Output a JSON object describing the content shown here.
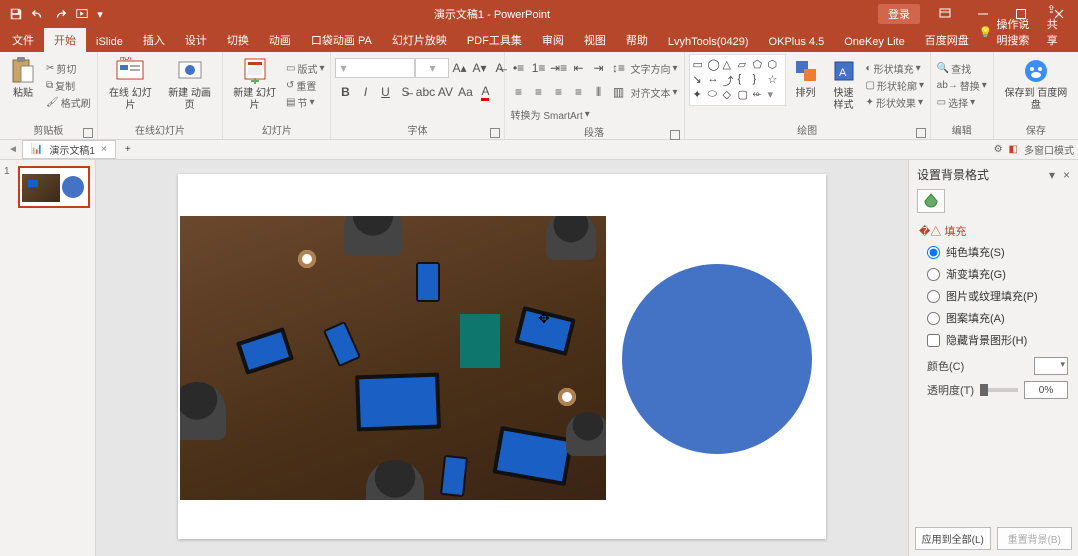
{
  "app": {
    "title": "演示文稿1 - PowerPoint",
    "login": "登录",
    "share": "共享",
    "hint": "操作说明搜索"
  },
  "tabs": [
    "文件",
    "开始",
    "iSlide",
    "插入",
    "设计",
    "切换",
    "动画",
    "口袋动画 PA",
    "幻灯片放映",
    "PDF工具集",
    "审阅",
    "视图",
    "帮助",
    "LvyhTools(0429)",
    "OKPlus 4.5",
    "OneKey Lite",
    "百度网盘"
  ],
  "active_tab": 1,
  "ribbon": {
    "clipboard": {
      "paste": "粘贴",
      "cut": "剪切",
      "copy": "复制",
      "painter": "格式刷",
      "label": "剪贴板"
    },
    "onlineslides": {
      "online": "在线\n幻灯片",
      "newpage": "新建\n动画页",
      "label": "在线幻灯片"
    },
    "slides": {
      "new": "新建\n幻灯片",
      "layout": "版式",
      "reset": "重置",
      "section": "节",
      "label": "幻灯片"
    },
    "font": {
      "label": "字体"
    },
    "paragraph": {
      "dir": "文字方向",
      "align": "对齐文本",
      "smart": "转换为 SmartArt",
      "label": "段落"
    },
    "drawing": {
      "arrange": "排列",
      "quick": "快速样式",
      "fill": "形状填充",
      "outline": "形状轮廓",
      "effects": "形状效果",
      "label": "绘图"
    },
    "editing": {
      "find": "查找",
      "replace": "替换",
      "select": "选择",
      "label": "编辑"
    },
    "save": {
      "btn": "保存到\n百度网盘",
      "label": "保存"
    }
  },
  "docbar": {
    "name": "演示文稿1",
    "multiwin": "多窗口模式"
  },
  "thumbs": {
    "n1": "1"
  },
  "pane": {
    "title": "设置背景格式",
    "section": "填充",
    "solid": "纯色填充(S)",
    "gradient": "渐变填充(G)",
    "picture": "图片或纹理填充(P)",
    "pattern": "图案填充(A)",
    "hide": "隐藏背景图形(H)",
    "color": "颜色(C)",
    "trans": "透明度(T)",
    "pct": "0%",
    "applyall": "应用到全部(L)",
    "reset": "重置背景(B)"
  }
}
